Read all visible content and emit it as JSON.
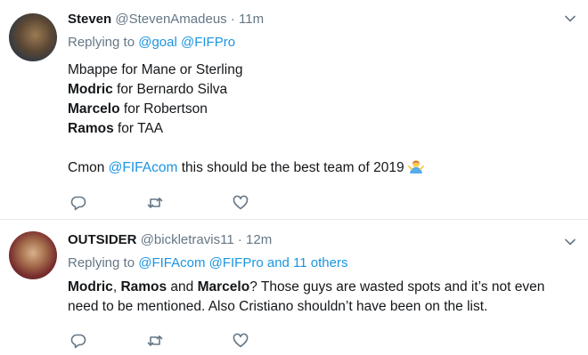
{
  "tweets": [
    {
      "name": "Steven",
      "handle": "@StevenAmadeus",
      "separator": "·",
      "time": "11m",
      "replying_prefix": "Replying to",
      "replying_to": [
        "@goal",
        "@FIFPro"
      ],
      "replying_suffix": "",
      "lines": [
        {
          "bold": "",
          "text": "Mbappe for Mane or Sterling"
        },
        {
          "bold": "Modric",
          "text": " for Bernardo Silva"
        },
        {
          "bold": "Marcelo",
          "text": " for Robertson"
        },
        {
          "bold": "Ramos",
          "text": " for TAA"
        }
      ],
      "closing": {
        "prefix": "Cmon ",
        "mention": "@FIFAcom",
        "suffix": " this should be the best team of 2019",
        "emoji": "woman-shrugging-emoji"
      }
    },
    {
      "name": "OUTSIDER",
      "handle": "@bickletravis11",
      "separator": "·",
      "time": "12m",
      "replying_prefix": "Replying to",
      "replying_to": [
        "@FIFAcom",
        "@FIFPro"
      ],
      "replying_suffix": "and 11 others",
      "body_bold_1": "Modric",
      "body_sep_1": ", ",
      "body_bold_2": "Ramos",
      "body_sep_2": " and ",
      "body_bold_3": "Marcelo",
      "body_rest_1": "? Those guys are wasted spots and it’s not even",
      "body_line_2": "need to be mentioned. Also Cristiano shouldn’t have been on the list."
    }
  ],
  "icons": [
    "reply-icon",
    "retweet-icon",
    "like-icon",
    "chevron-down-icon"
  ],
  "colors": {
    "link": "#1b95e0",
    "secondary": "#657786",
    "divider": "#e6ecf0"
  }
}
